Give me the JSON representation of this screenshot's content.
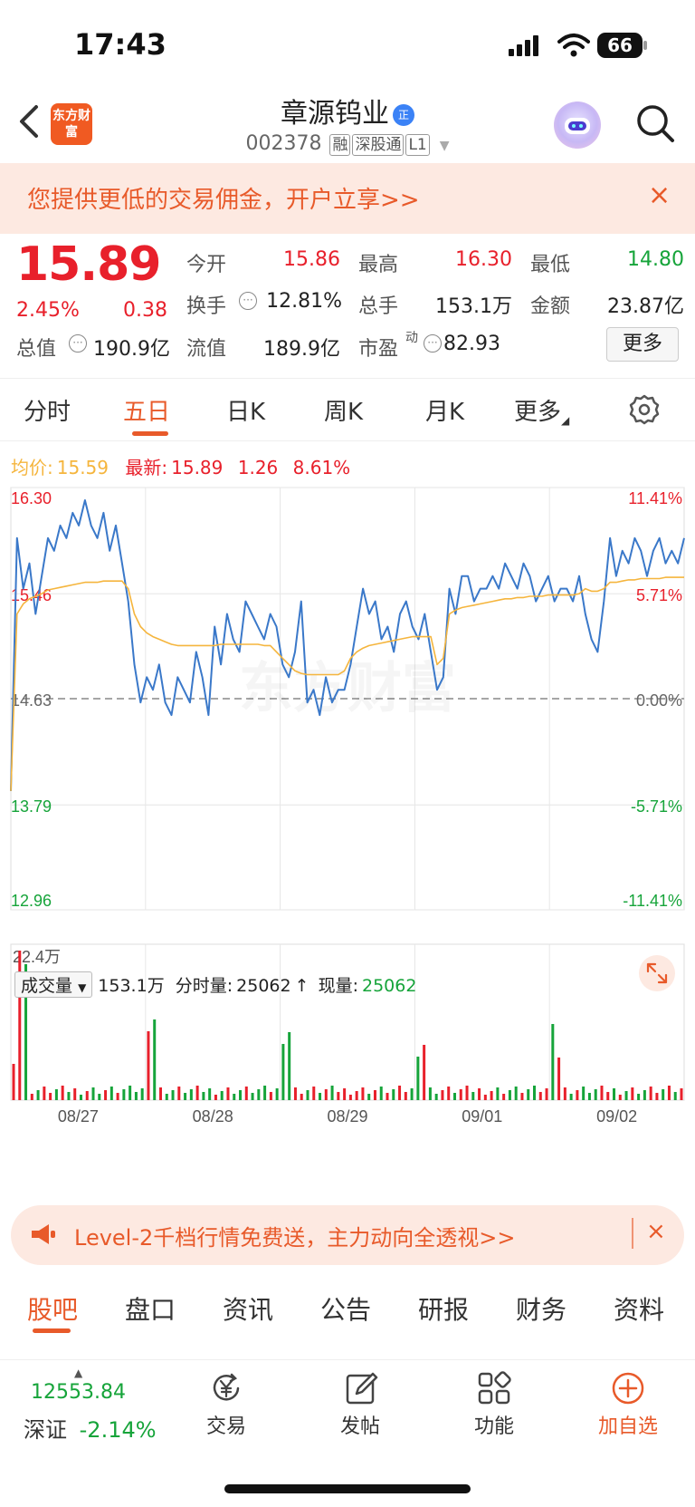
{
  "status_bar": {
    "time": "17:43",
    "battery": "66"
  },
  "header": {
    "brand_logo": "东方财富",
    "stock_name": "章源钨业",
    "name_badge": "正",
    "stock_code": "002378",
    "tags": [
      "融",
      "深股通",
      "L1"
    ]
  },
  "promo": {
    "text": "您提供更低的交易佣金，开户立享>>",
    "close": "×"
  },
  "quote": {
    "price": "15.89",
    "change_pct": "2.45%",
    "change_amt": "0.38",
    "rows": [
      [
        {
          "label": "今开",
          "value": "15.86",
          "color": "red"
        },
        {
          "label": "最高",
          "value": "16.30",
          "color": "red"
        },
        {
          "label": "最低",
          "value": "14.80",
          "color": "green"
        }
      ],
      [
        {
          "label": "换手",
          "value": "12.81%",
          "color": "normal"
        },
        {
          "label": "总手",
          "value": "153.1万",
          "color": "normal"
        },
        {
          "label": "金额",
          "value": "23.87亿",
          "color": "normal"
        }
      ]
    ],
    "row3": [
      {
        "label": "总值",
        "value": "190.9亿"
      },
      {
        "label": "流值",
        "value": "189.9亿"
      },
      {
        "label": "市盈",
        "sup": "动",
        "value": "82.93"
      }
    ],
    "more_button": "更多"
  },
  "period_tabs": [
    "分时",
    "五日",
    "日K",
    "周K",
    "月K",
    "更多"
  ],
  "active_period_tab": "五日",
  "chart_header": {
    "avg_label": "均价:",
    "avg_value": "15.59",
    "latest_label": "最新:",
    "latest_value": "15.89",
    "latest_change": "1.26",
    "latest_pct": "8.61%"
  },
  "chart_data": {
    "type": "line",
    "title": "",
    "left_ticks": [
      "16.30",
      "15.46",
      "14.63",
      "13.79",
      "12.96"
    ],
    "right_ticks": [
      "11.41%",
      "5.71%",
      "0.00%",
      "-5.71%",
      "-11.41%"
    ],
    "ylim": [
      12.96,
      16.3
    ],
    "reference_price": 14.63,
    "x_dates": [
      "08/27",
      "08/28",
      "08/29",
      "09/01",
      "09/02"
    ],
    "series": [
      {
        "name": "price",
        "color": "#3a78c9",
        "values": [
          13.9,
          15.9,
          15.5,
          15.7,
          15.3,
          15.6,
          15.9,
          15.8,
          16.0,
          15.9,
          16.1,
          16.0,
          16.2,
          16.0,
          15.9,
          16.1,
          15.8,
          16.0,
          15.7,
          15.4,
          14.9,
          14.6,
          14.8,
          14.7,
          14.9,
          14.6,
          14.5,
          14.8,
          14.7,
          14.6,
          15.0,
          14.8,
          14.5,
          15.2,
          14.9,
          15.3,
          15.1,
          15.0,
          15.4,
          15.3,
          15.2,
          15.1,
          15.3,
          15.2,
          14.9,
          14.8,
          15.0,
          15.4,
          14.6,
          14.7,
          14.5,
          14.8,
          14.6,
          14.7,
          14.7,
          14.9,
          15.2,
          15.5,
          15.3,
          15.4,
          15.1,
          15.2,
          15.0,
          15.3,
          15.4,
          15.2,
          15.1,
          15.3,
          15.0,
          14.7,
          14.8,
          15.5,
          15.3,
          15.6,
          15.6,
          15.4,
          15.5,
          15.5,
          15.6,
          15.5,
          15.7,
          15.6,
          15.5,
          15.7,
          15.6,
          15.4,
          15.5,
          15.6,
          15.4,
          15.5,
          15.5,
          15.4,
          15.6,
          15.3,
          15.1,
          15.0,
          15.4,
          15.9,
          15.6,
          15.8,
          15.7,
          15.9,
          15.8,
          15.6,
          15.8,
          15.9,
          15.7,
          15.8,
          15.7,
          15.9
        ]
      },
      {
        "name": "avg",
        "color": "#f5b53d",
        "values": [
          13.9,
          15.3,
          15.38,
          15.42,
          15.44,
          15.46,
          15.49,
          15.5,
          15.51,
          15.52,
          15.53,
          15.54,
          15.55,
          15.55,
          15.55,
          15.56,
          15.56,
          15.56,
          15.56,
          15.5,
          15.3,
          15.2,
          15.15,
          15.12,
          15.1,
          15.08,
          15.06,
          15.05,
          15.05,
          15.05,
          15.05,
          15.05,
          15.05,
          15.05,
          15.06,
          15.06,
          15.06,
          15.06,
          15.06,
          15.06,
          15.06,
          15.05,
          15.05,
          15.0,
          14.95,
          14.9,
          14.85,
          14.83,
          14.82,
          14.82,
          14.82,
          14.82,
          14.82,
          14.82,
          14.85,
          14.95,
          15.0,
          15.03,
          15.05,
          15.06,
          15.07,
          15.08,
          15.09,
          15.1,
          15.11,
          15.12,
          15.12,
          15.12,
          15.12,
          14.9,
          14.95,
          15.3,
          15.33,
          15.35,
          15.36,
          15.37,
          15.38,
          15.39,
          15.4,
          15.41,
          15.42,
          15.42,
          15.43,
          15.43,
          15.44,
          15.44,
          15.44,
          15.45,
          15.45,
          15.45,
          15.45,
          15.45,
          15.46,
          15.5,
          15.48,
          15.48,
          15.5,
          15.55,
          15.55,
          15.56,
          15.57,
          15.57,
          15.58,
          15.58,
          15.58,
          15.58,
          15.59,
          15.59,
          15.59,
          15.59
        ]
      }
    ]
  },
  "volume": {
    "selector": "成交量",
    "total": "153.1万",
    "period_vol_label": "分时量:",
    "period_vol": "25062",
    "current_label": "现量:",
    "current_vol": "25062",
    "max_label": "22.4万"
  },
  "level2_banner": {
    "text": "Level-2千档行情免费送，主力动向全透视>>",
    "close": "×"
  },
  "section_tabs": [
    "股吧",
    "盘口",
    "资讯",
    "公告",
    "研报",
    "财务",
    "资料"
  ],
  "active_section_tab": "股吧",
  "dock": {
    "index_value": "12553.84",
    "index_name": "深证",
    "index_change": "-2.14%",
    "items": [
      "交易",
      "发帖",
      "功能",
      "加自选"
    ]
  },
  "colors": {
    "accent": "#e85a2a",
    "up": "#e8202b",
    "down": "#16a43a",
    "price_line": "#3a78c9",
    "avg_line": "#f5b53d"
  }
}
